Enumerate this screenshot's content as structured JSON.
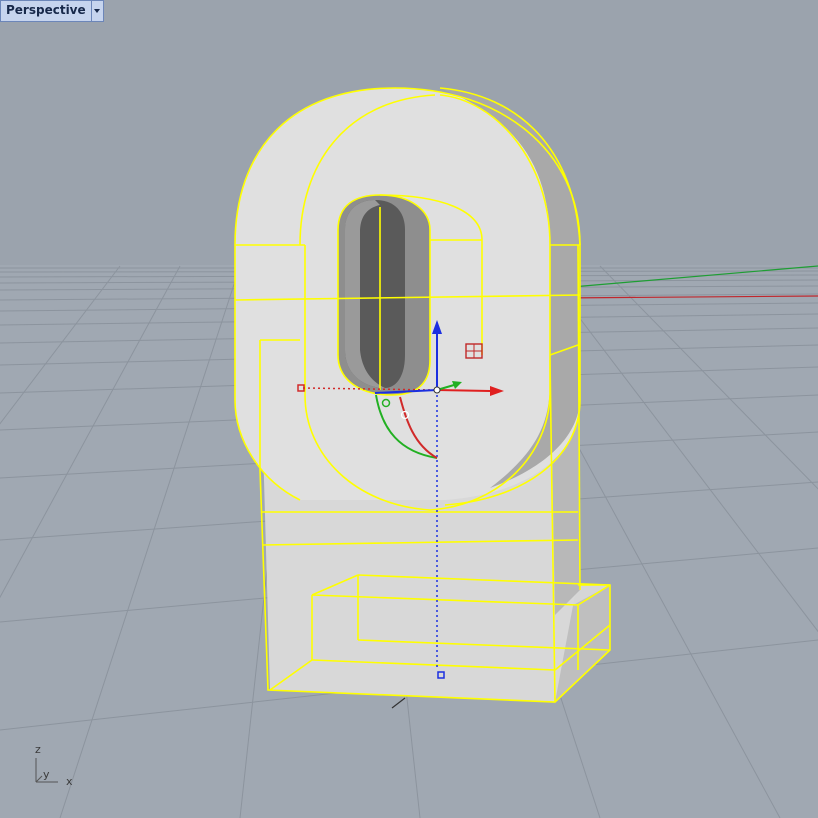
{
  "viewport": {
    "name": "Perspective",
    "axis_labels": {
      "z": "z",
      "y": "y",
      "x": "x"
    }
  },
  "colors": {
    "background": "#9ba3ad",
    "grid": "#8d959f",
    "selection": "#ffff00",
    "surface": "#dcdcdc",
    "x_axis": "#d12a2a",
    "y_axis": "#1faa1f",
    "z_axis": "#1b2fe0",
    "tab_fill": "#c6d4ee",
    "tab_border": "#6c86b9"
  },
  "gizmo": {
    "icons": [
      "move-arrow-x",
      "move-arrow-y",
      "move-arrow-z",
      "rotate-arc-x",
      "rotate-arc-y",
      "scale-handle",
      "plane-handle"
    ]
  }
}
